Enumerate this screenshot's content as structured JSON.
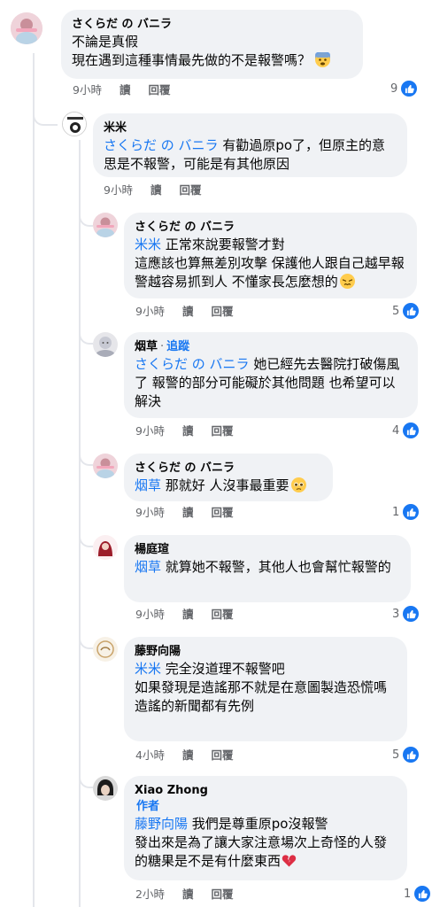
{
  "comments": [
    {
      "author": "さくらだ の バニラ",
      "lines": [
        "不論是真假",
        "現在遇到這種事情最先做的不是報警嗎？"
      ],
      "emoji": "fearful-face",
      "time": "9小時",
      "read": "讀",
      "reply": "回覆",
      "likes": "9"
    },
    {
      "author": "米米",
      "mention": "さくらだ の バニラ",
      "text": " 有勸過原po了，但原主的意思是不報警，可能是有其他原因",
      "time": "9小時",
      "read": "讀",
      "reply": "回覆"
    },
    {
      "author": "さくらだ の バニラ",
      "mention": "米米",
      "text": " 正常來說要報警才對\n這應該也算無差別攻擊  保護他人跟自己越早報警越容易抓到人 不懂家長怎麼想的",
      "emoji": "persevering-face",
      "time": "9小時",
      "read": "讀",
      "reply": "回覆",
      "likes": "5"
    },
    {
      "author": "烟草",
      "dot": "·",
      "follow": "追蹤",
      "mention": "さくらだ の バニラ",
      "text": " 她已經先去醫院打破傷風了 報警的部分可能礙於其他問題 也希望可以解決",
      "time": "9小時",
      "read": "讀",
      "reply": "回覆",
      "likes": "4"
    },
    {
      "author": "さくらだ の バニラ",
      "mention": "烟草",
      "text": " 那就好 人沒事最重要",
      "emoji": "pleading-face",
      "time": "9小時",
      "read": "讀",
      "reply": "回覆",
      "likes": "1"
    },
    {
      "author": "楊庭瑄",
      "mention": "烟草",
      "text": " 就算她不報警，其他人也會幫忙報警的",
      "time": "9小時",
      "read": "讀",
      "reply": "回覆",
      "likes": "3"
    },
    {
      "author": "藤野向陽",
      "mention": "米米",
      "text": " 完全沒道理不報警吧\n如果發現是造謠那不就是在意圖製造恐慌嗎\n造謠的新聞都有先例",
      "time": "4小時",
      "read": "讀",
      "reply": "回覆",
      "likes": "5"
    },
    {
      "author": "Xiao Zhong",
      "badge": "作者",
      "mention": "藤野向陽",
      "text": " 我們是尊重原po沒報警\n發出來是為了讓大家注意場次上奇怪的人發的糖果是不是有什麼東西",
      "emoji": "broken-heart",
      "time": "2小時",
      "read": "讀",
      "reply": "回覆",
      "likes": "1"
    }
  ],
  "colors": {
    "accent": "#1877f2",
    "bubble": "#f0f2f5",
    "meta": "#65676b"
  },
  "icons": {
    "like": "thumbs-up-icon"
  }
}
